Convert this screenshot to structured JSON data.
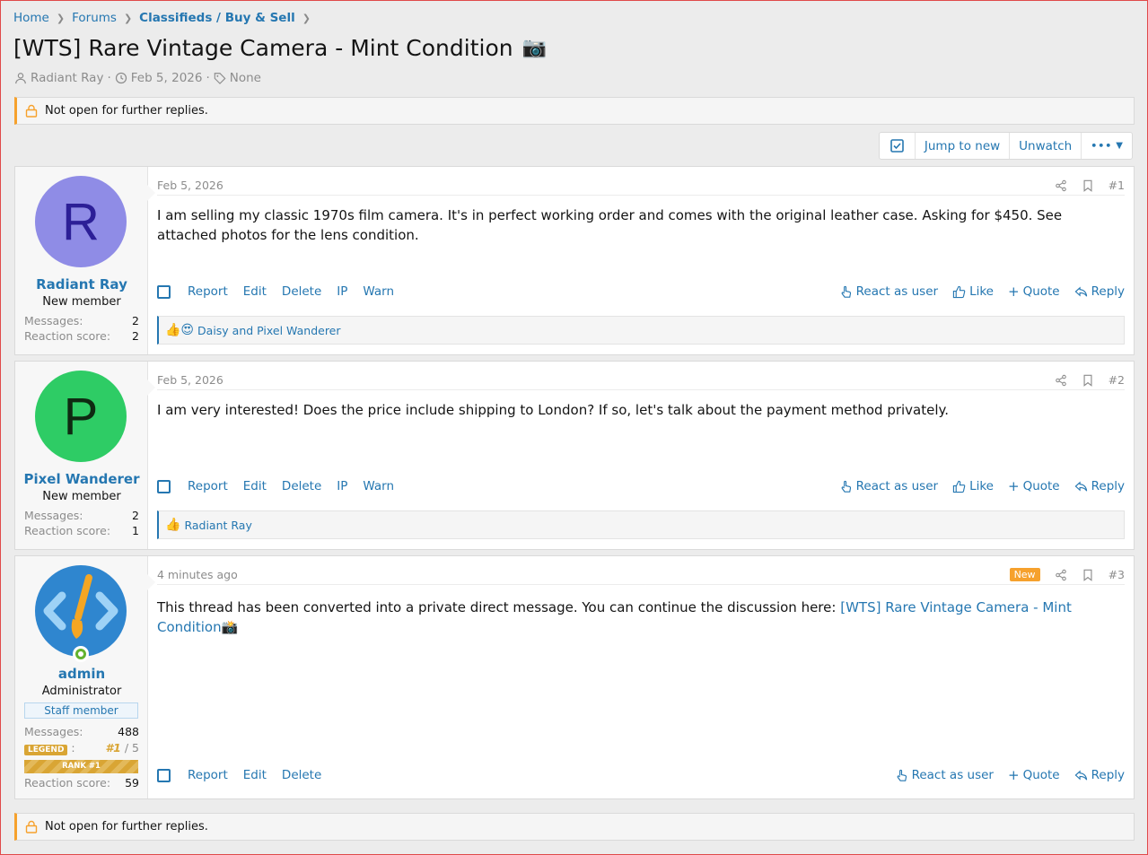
{
  "breadcrumb": [
    "Home",
    "Forums",
    "Classifieds / Buy & Sell"
  ],
  "thread": {
    "title": "[WTS] Rare Vintage Camera - Mint Condition",
    "title_emoji": "📷",
    "author": "Radiant Ray",
    "date": "Feb 5, 2026",
    "tags": "None",
    "sep": "·"
  },
  "notice": "Not open for further replies.",
  "toolbar": {
    "jump_new": "Jump to new",
    "unwatch": "Unwatch",
    "more": "•••"
  },
  "posts": [
    {
      "date": "Feb 5, 2026",
      "num": "#1",
      "avatar_letter": "R",
      "avatar_bg": "#8f8ce6",
      "avatar_fg": "#2c1f97",
      "username": "Radiant Ray",
      "usertitle": "New member",
      "messages_label": "Messages:",
      "messages": "2",
      "reaction_label": "Reaction score:",
      "reaction_score": "2",
      "body": "I am selling my classic 1970s film camera. It's in perfect working order and comes with the original leather case. Asking for $450. See attached photos for the lens condition.",
      "reaction_emoji": "👍😍",
      "reaction_users": "Daisy and Pixel Wanderer"
    },
    {
      "date": "Feb 5, 2026",
      "num": "#2",
      "avatar_letter": "P",
      "avatar_bg": "#2ecc65",
      "avatar_fg": "#0f2a12",
      "username": "Pixel Wanderer",
      "usertitle": "New member",
      "messages_label": "Messages:",
      "messages": "2",
      "reaction_label": "Reaction score:",
      "reaction_score": "1",
      "body": "I am very interested! Does the price include shipping to London? If so, let's talk about the payment method privately.",
      "reaction_emoji": "👍",
      "reaction_users": "Radiant Ray"
    },
    {
      "date": "4 minutes ago",
      "new": "New",
      "num": "#3",
      "username": "admin",
      "usertitle": "Administrator",
      "staff": "Staff member",
      "messages_label": "Messages:",
      "messages": "488",
      "legend": "LEGEND",
      "legend_colon": ":",
      "legend_rank": "#1",
      "legend_total": "/ 5",
      "rank_bar": "RANK #1",
      "reaction_label": "Reaction score:",
      "reaction_score": "59",
      "body_prefix": "This thread has been converted into a private direct message. You can continue the discussion here:",
      "body_link": "[WTS] Rare Vintage Camera - Mint Condition",
      "body_emoji": "📸"
    }
  ],
  "actions": {
    "report": "Report",
    "edit": "Edit",
    "delete": "Delete",
    "ip": "IP",
    "warn": "Warn",
    "react_as_user": "React as user",
    "like": "Like",
    "quote": "Quote",
    "reply": "Reply",
    "plus": "+"
  },
  "colors": {
    "link": "#2577b1",
    "notice_accent": "#f6a12d"
  }
}
